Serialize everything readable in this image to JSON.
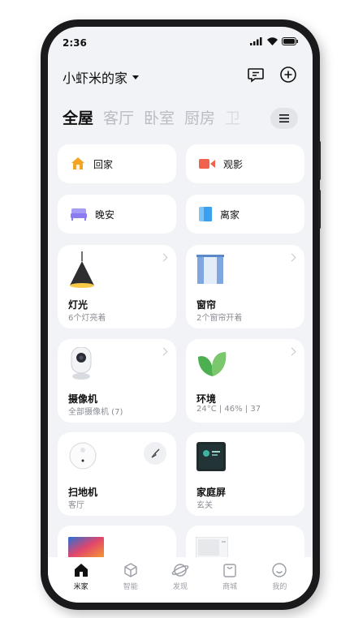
{
  "status": {
    "time": "2:36"
  },
  "home": {
    "title": "小虾米的家"
  },
  "tabs": [
    {
      "label": "全屋"
    },
    {
      "label": "客厅"
    },
    {
      "label": "卧室"
    },
    {
      "label": "厨房"
    },
    {
      "label": "卫"
    }
  ],
  "scenes": [
    {
      "label": "回家",
      "icon": "house-icon",
      "color": "#f5a524"
    },
    {
      "label": "观影",
      "icon": "video-camera-icon",
      "color": "#f0624d"
    },
    {
      "label": "晚安",
      "icon": "bed-icon",
      "color": "#8a7cf0"
    },
    {
      "label": "离家",
      "icon": "door-icon",
      "color": "#3aa0f0"
    }
  ],
  "devices": [
    {
      "name": "灯光",
      "sub": "6个灯亮着",
      "icon": "pendant-lamp-icon"
    },
    {
      "name": "窗帘",
      "sub": "2个窗帘开着",
      "icon": "curtain-icon"
    },
    {
      "name": "摄像机",
      "sub": "全部摄像机 (7)",
      "icon": "security-camera-icon"
    },
    {
      "name": "环境",
      "sub": "24°C | 46% | 37",
      "icon": "leaf-icon"
    },
    {
      "name": "扫地机",
      "sub": "客厅",
      "icon": "robot-vacuum-icon"
    },
    {
      "name": "家庭屏",
      "sub": "玄关",
      "icon": "smart-display-icon"
    }
  ],
  "nav": [
    {
      "label": "米家",
      "icon": "home-icon"
    },
    {
      "label": "智能",
      "icon": "smart-cube-icon"
    },
    {
      "label": "发现",
      "icon": "planet-icon"
    },
    {
      "label": "商城",
      "icon": "shop-bag-icon"
    },
    {
      "label": "我的",
      "icon": "smiley-icon"
    }
  ]
}
